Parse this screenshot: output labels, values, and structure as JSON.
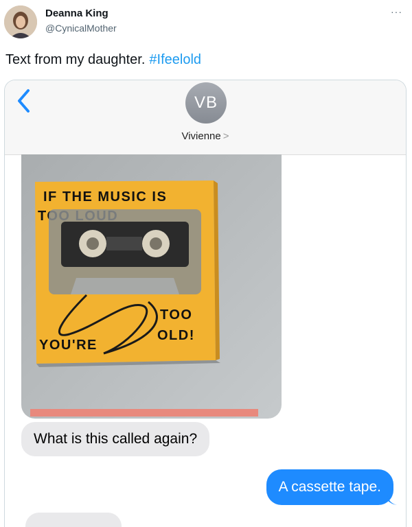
{
  "tweet": {
    "author_name": "Deanna King",
    "author_handle": "@CynicalMother",
    "more_label": "···",
    "text": "Text from my daughter.",
    "hashtag": "#Ifeelold"
  },
  "imessage": {
    "contact_initials": "VB",
    "contact_name": "Vivienne",
    "contact_chevron": ">",
    "messages": [
      {
        "from": "them",
        "text": "What is this called again?"
      },
      {
        "from": "me",
        "text": "A cassette tape."
      }
    ]
  },
  "art": {
    "line1": "IF THE MUSIC IS",
    "line2": "TOO LOUD",
    "line3": "YOU'RE",
    "line4": "TOO",
    "line5": "OLD!"
  },
  "colors": {
    "link": "#1d9bf0",
    "imessage_blue": "#1e8bff",
    "incoming_bubble": "#e9e9eb",
    "art_yellow": "#f2b230"
  }
}
